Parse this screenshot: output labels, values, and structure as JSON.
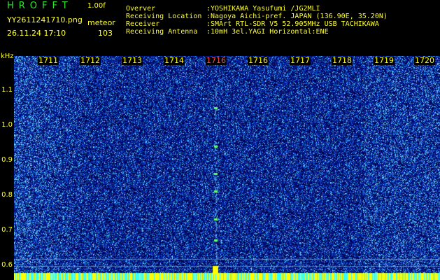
{
  "header": {
    "app_title": "HROFFT",
    "version": "1.00f",
    "filename": "YY2611241710.png",
    "timestamp": "26.11.24 17:10",
    "meteor_label": "meteor",
    "meteor_count": "103"
  },
  "info": [
    {
      "key": "Overver",
      "value": ":YOSHIKAWA Yasufumi /JG2MLI"
    },
    {
      "key": "Receiving Location",
      "value": ":Nagoya Aichi-pref. JAPAN (136.90E, 35.20N)"
    },
    {
      "key": "Receiver",
      "value": ":SMArt RTL-SDR V5 52.905MHz USB TACHIKAWA"
    },
    {
      "key": "Receiving Antenna",
      "value": ":10mH 3el.YAGI Horizontal:ENE"
    }
  ],
  "axes": {
    "y_unit": "kHz",
    "y_ticks": [
      "1.1",
      "1.0",
      "0.9",
      "0.8",
      "0.7",
      "0.6"
    ],
    "x_ticks": [
      "1711",
      "1712",
      "1713",
      "1714",
      "1716",
      "1716",
      "1717",
      "1718",
      "1719",
      "1720"
    ]
  },
  "colors": {
    "background": "#000000",
    "label": "#ffff33",
    "title": "#2ee62e",
    "marker_active": "#ff5050"
  }
}
